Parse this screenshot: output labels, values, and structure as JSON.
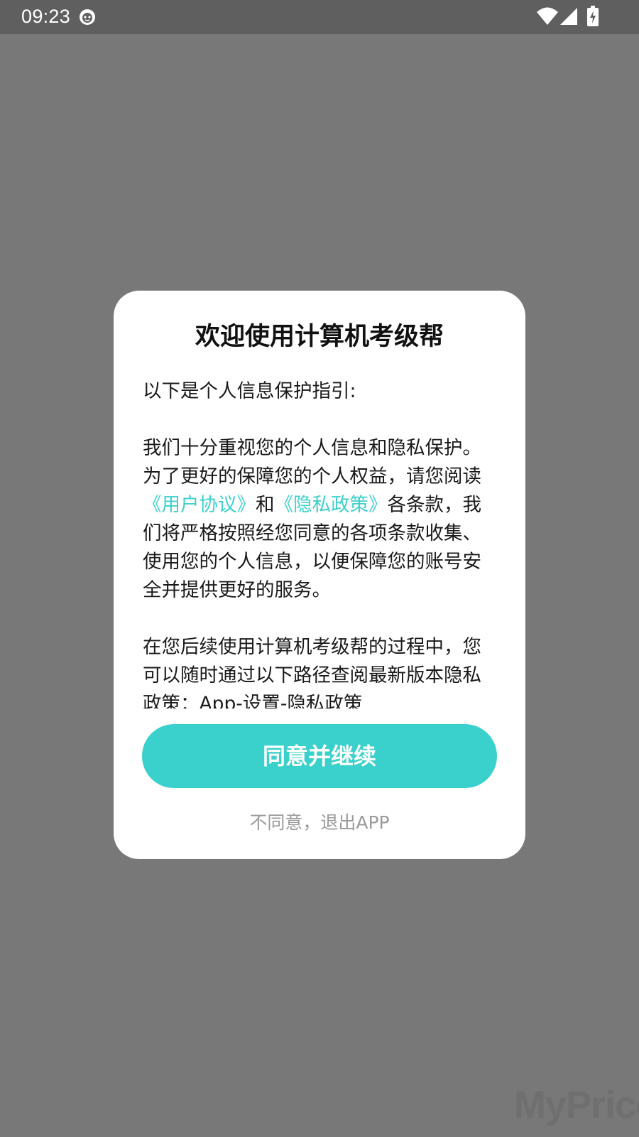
{
  "status_bar": {
    "time": "09:23",
    "icons": [
      "cat-icon",
      "wifi-icon",
      "signal-icon",
      "battery-charging-icon"
    ]
  },
  "dialog": {
    "title": "欢迎使用计算机考级帮",
    "intro": "以下是个人信息保护指引:",
    "para2_before": "我们十分重视您的个人信息和隐私保护。为了更好的保障您的个人权益，请您阅读",
    "user_agreement_link": "《用户协议》",
    "and": "和",
    "privacy_policy_link": "《隐私政策》",
    "para2_after": "各条款，我们将严格按照经您同意的各项条款收集、使用您的个人信息，以便保障您的账号安全并提供更好的服务。",
    "para3": "在您后续使用计算机考级帮的过程中，您可以随时通过以下路径查阅最新版本隐私政策：App-设置-隐私政策",
    "agree_button": "同意并继续",
    "disagree_link": "不同意，退出APP"
  },
  "watermark": "MyPrice",
  "colors": {
    "accent": "#3ad0cb",
    "link": "#3dd0cc",
    "overlay": "#787878",
    "status_bar": "#5f5f5f"
  }
}
